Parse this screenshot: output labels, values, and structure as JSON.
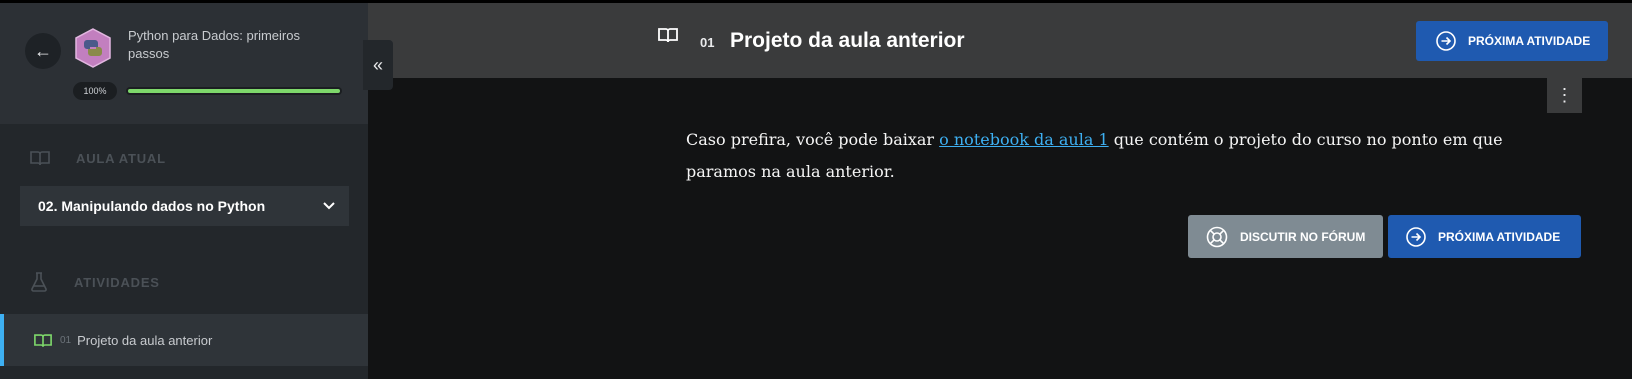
{
  "sidebar": {
    "course_title": "Python para Dados: primeiros passos",
    "progress_label": "100%",
    "progress_value": 1.0,
    "section_current_label": "AULA ATUAL",
    "current_lesson": "02. Manipulando dados no Python",
    "section_activities_label": "ATIVIDADES",
    "activities": [
      {
        "number": "01",
        "title": "Projeto da aula anterior"
      }
    ]
  },
  "header": {
    "activity_number": "01",
    "activity_title": "Projeto da aula anterior",
    "next_label": "PRÓXIMA ATIVIDADE"
  },
  "content": {
    "text_before": "Caso prefira, você pode baixar ",
    "link_text": "o notebook da aula 1",
    "text_after": " que contém o projeto do curso no ponto em que paramos na aula anterior."
  },
  "actions": {
    "forum_label": "DISCUTIR NO FÓRUM",
    "next_label": "PRÓXIMA ATIVIDADE"
  },
  "colors": {
    "accent": "#1f5ab0",
    "progress": "#7ed86b",
    "link": "#3eb0f2",
    "active_marker": "#3eb0f2"
  }
}
